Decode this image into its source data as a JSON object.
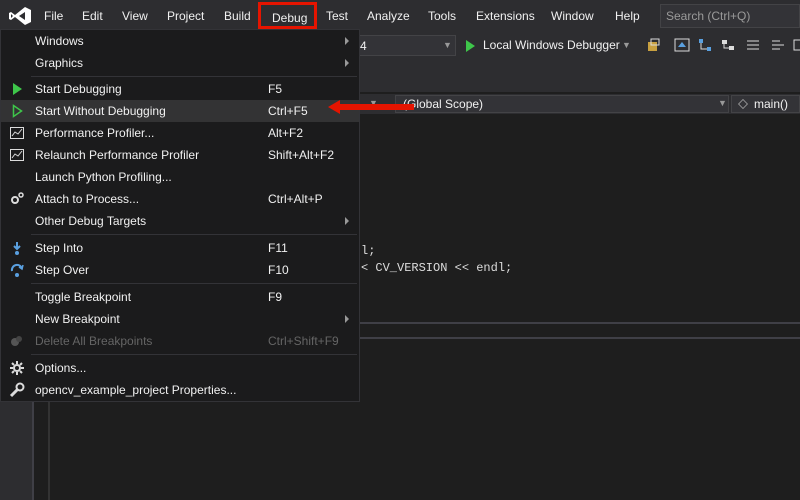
{
  "menubar": {
    "items": [
      "File",
      "Edit",
      "View",
      "Project",
      "Build",
      "Debug",
      "Test",
      "Analyze",
      "Tools",
      "Extensions",
      "Window",
      "Help"
    ],
    "search_placeholder": "Search (Ctrl+Q)"
  },
  "toolbar": {
    "platform": "4",
    "run_label": "Local Windows Debugger"
  },
  "navbar": {
    "scope": "(Global Scope)",
    "member": "main()"
  },
  "code": {
    "line1": "l;",
    "line2": "< CV_VERSION << endl;"
  },
  "debug_menu": {
    "items": [
      {
        "label": "Windows",
        "shortcut": ""
      },
      {
        "label": "Graphics",
        "shortcut": ""
      },
      {
        "label": "Start Debugging",
        "shortcut": "F5"
      },
      {
        "label": "Start Without Debugging",
        "shortcut": "Ctrl+F5"
      },
      {
        "label": "Performance Profiler...",
        "shortcut": "Alt+F2"
      },
      {
        "label": "Relaunch Performance Profiler",
        "shortcut": "Shift+Alt+F2"
      },
      {
        "label": "Launch Python Profiling...",
        "shortcut": ""
      },
      {
        "label": "Attach to Process...",
        "shortcut": "Ctrl+Alt+P"
      },
      {
        "label": "Other Debug Targets",
        "shortcut": ""
      },
      {
        "label": "Step Into",
        "shortcut": "F11"
      },
      {
        "label": "Step Over",
        "shortcut": "F10"
      },
      {
        "label": "Toggle Breakpoint",
        "shortcut": "F9"
      },
      {
        "label": "New Breakpoint",
        "shortcut": ""
      },
      {
        "label": "Delete All Breakpoints",
        "shortcut": "Ctrl+Shift+F9"
      },
      {
        "label": "Options...",
        "shortcut": ""
      },
      {
        "label": "opencv_example_project Properties...",
        "shortcut": ""
      }
    ]
  },
  "colors": {
    "accent_red": "#e51400",
    "run_green": "#3ec64a",
    "menu_bg": "#1b1b1c",
    "chrome_bg": "#2d2d30"
  }
}
